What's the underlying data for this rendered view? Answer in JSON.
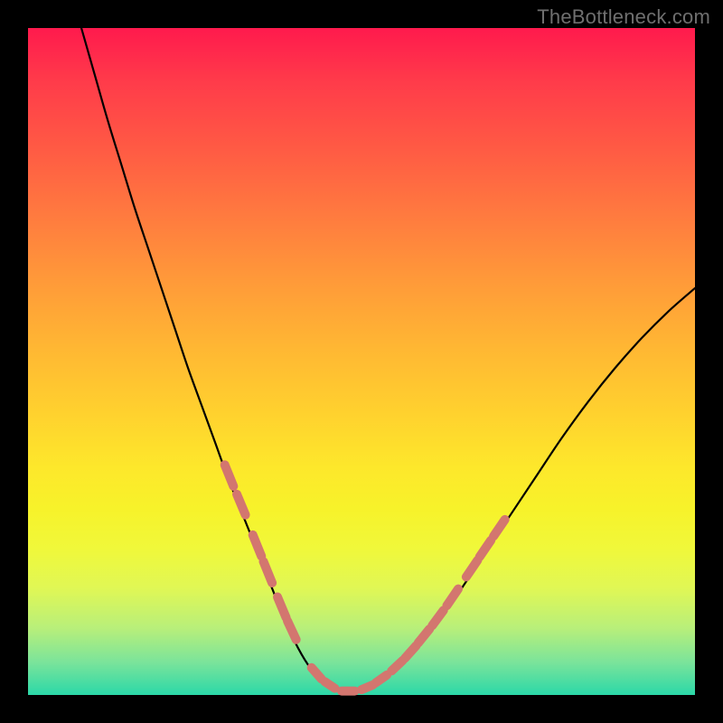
{
  "watermark": "TheBottleneck.com",
  "colors": {
    "page_bg": "#000000",
    "curve_stroke": "#000000",
    "highlight_stroke": "#d3766f"
  },
  "chart_data": {
    "type": "line",
    "title": "",
    "xlabel": "",
    "ylabel": "",
    "xlim": [
      0,
      100
    ],
    "ylim": [
      0,
      100
    ],
    "series": [
      {
        "name": "bottleneck-curve",
        "x": [
          8,
          10,
          12,
          14,
          16,
          18,
          20,
          22,
          24,
          26,
          28,
          30,
          32,
          34,
          36,
          38,
          40,
          42,
          44,
          48,
          52,
          56,
          60,
          64,
          68,
          72,
          76,
          80,
          84,
          88,
          92,
          96,
          100
        ],
        "y": [
          100,
          93,
          86,
          79.5,
          73,
          67,
          61,
          55,
          49,
          43.5,
          38,
          32.5,
          27.5,
          22.5,
          17.5,
          12.5,
          8,
          4.5,
          2,
          0.5,
          1.5,
          4.5,
          9,
          14.5,
          20.5,
          26.5,
          32.5,
          38.5,
          44,
          49,
          53.5,
          57.5,
          61
        ]
      }
    ],
    "highlight_segments": [
      {
        "name": "left-dash-1",
        "x": [
          29.5,
          30.8
        ],
        "y": [
          34.5,
          31.3
        ]
      },
      {
        "name": "left-dash-2",
        "x": [
          31.3,
          32.6
        ],
        "y": [
          30.1,
          27.0
        ]
      },
      {
        "name": "left-dash-3",
        "x": [
          33.7,
          35.0
        ],
        "y": [
          24.0,
          20.8
        ]
      },
      {
        "name": "left-dash-4",
        "x": [
          35.3,
          36.6
        ],
        "y": [
          20.0,
          16.8
        ]
      },
      {
        "name": "left-dash-5",
        "x": [
          37.4,
          38.7
        ],
        "y": [
          14.7,
          11.6
        ]
      },
      {
        "name": "left-dash-6",
        "x": [
          38.9,
          40.2
        ],
        "y": [
          11.1,
          8.3
        ]
      },
      {
        "name": "bottom-dash-1",
        "x": [
          42.5,
          44.0
        ],
        "y": [
          4.1,
          2.4
        ]
      },
      {
        "name": "bottom-dash-2",
        "x": [
          44.5,
          46.0
        ],
        "y": [
          2.0,
          1.0
        ]
      },
      {
        "name": "bottom-dash-3",
        "x": [
          47.0,
          49.0
        ],
        "y": [
          0.6,
          0.6
        ]
      },
      {
        "name": "bottom-dash-4",
        "x": [
          50.0,
          51.7
        ],
        "y": [
          0.8,
          1.5
        ]
      },
      {
        "name": "bottom-dash-5",
        "x": [
          52.1,
          53.8
        ],
        "y": [
          1.8,
          3.0
        ]
      },
      {
        "name": "right-dash-1",
        "x": [
          54.5,
          56.2
        ],
        "y": [
          3.6,
          5.2
        ]
      },
      {
        "name": "right-dash-2",
        "x": [
          56.5,
          58.2
        ],
        "y": [
          5.5,
          7.4
        ]
      },
      {
        "name": "right-dash-3",
        "x": [
          58.5,
          60.2
        ],
        "y": [
          7.8,
          9.9
        ]
      },
      {
        "name": "right-dash-4",
        "x": [
          60.6,
          62.3
        ],
        "y": [
          10.4,
          12.7
        ]
      },
      {
        "name": "right-dash-5",
        "x": [
          62.8,
          64.5
        ],
        "y": [
          13.4,
          15.9
        ]
      },
      {
        "name": "right-dash-6",
        "x": [
          65.7,
          67.4
        ],
        "y": [
          17.7,
          20.2
        ]
      },
      {
        "name": "right-dash-7",
        "x": [
          67.7,
          69.4
        ],
        "y": [
          20.7,
          23.2
        ]
      },
      {
        "name": "right-dash-8",
        "x": [
          69.8,
          71.5
        ],
        "y": [
          23.8,
          26.3
        ]
      }
    ]
  }
}
